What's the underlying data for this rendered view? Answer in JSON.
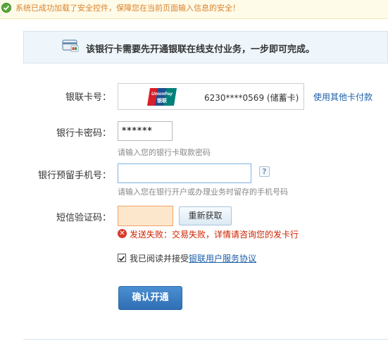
{
  "notice": {
    "text": "系统已成功加载了安全控件，保障您在当前页面输入信息的安全！"
  },
  "banner": {
    "text": "该银行卡需要先开通银联在线支付业务，一步即可完成。"
  },
  "card": {
    "label": "银联卡号：",
    "logo_text": "UnionPay 银联",
    "number": "6230****0569 (储蓄卡)",
    "other_link": "使用其他卡付款"
  },
  "password": {
    "label": "银行卡密码：",
    "value": "******",
    "hint": "请输入您的银行卡取款密码"
  },
  "phone": {
    "label": "银行预留手机号：",
    "value": "",
    "help": "?",
    "hint": "请输入您在银行开户或办理业务时留存的手机号码"
  },
  "sms": {
    "label": "短信验证码：",
    "value": "",
    "resend": "重新获取",
    "error": "发送失败：交易失败，详情请咨询您的发卡行"
  },
  "agreement": {
    "checked": true,
    "text": "我已阅读并接受",
    "link": "银联用户服务协议"
  },
  "confirm_button": "确认开通",
  "colors": {
    "link": "#1b5ea8",
    "error": "#cc2200",
    "notice": "#d9822b",
    "button": "#2f6fb4"
  }
}
